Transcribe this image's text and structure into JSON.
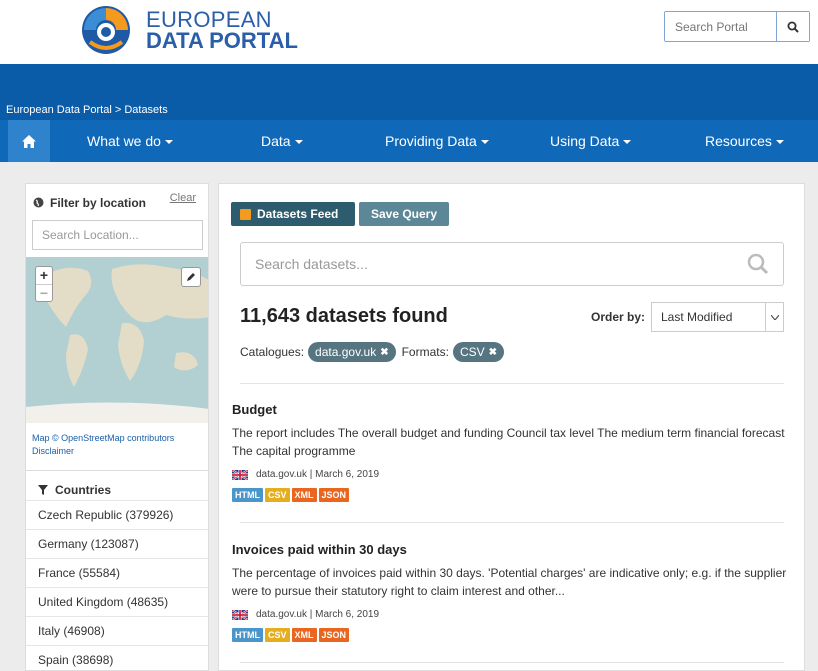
{
  "header": {
    "logo_line1": "EUROPEAN",
    "logo_line2": "DATA PORTAL",
    "search_placeholder": "Search Portal",
    "search_icon": "search-icon"
  },
  "breadcrumb": "European Data Portal > Datasets",
  "nav": {
    "home_icon": "home-icon",
    "items": [
      {
        "label": "What we do"
      },
      {
        "label": "Data"
      },
      {
        "label": "Providing Data"
      },
      {
        "label": "Using Data"
      },
      {
        "label": "Resources"
      }
    ]
  },
  "sidebar": {
    "filter_title": "Filter by location",
    "clear_label": "Clear",
    "location_placeholder": "Search Location...",
    "map_attribution": "Map © OpenStreetMap contributors",
    "map_disclaimer": "Disclaimer",
    "countries_title": "Countries",
    "countries": [
      "Czech Republic (379926)",
      "Germany (123087)",
      "France (55584)",
      "United Kingdom (48635)",
      "Italy (46908)",
      "Spain (38698)"
    ]
  },
  "main": {
    "feed_button": "Datasets Feed",
    "save_button": "Save Query",
    "search_placeholder": "Search datasets...",
    "results_count": "11,643 datasets found",
    "order_label": "Order by:",
    "order_value": "Last Modified",
    "catalogues_label": "Catalogues:",
    "catalogue_pill": "data.gov.uk",
    "formats_label": "Formats:",
    "format_pill": "CSV",
    "datasets": [
      {
        "title": "Budget",
        "description": "The report includes The overall budget and funding Council tax level The medium term financial forecast The capital programme",
        "meta": "data.gov.uk | March 6, 2019",
        "formats": [
          "HTML",
          "CSV",
          "XML",
          "JSON"
        ]
      },
      {
        "title": "Invoices paid within 30 days",
        "description": "The percentage of invoices paid within 30 days. 'Potential charges' are indicative only; e.g. if the supplier were to pursue their statutory right to claim interest and other...",
        "meta": "data.gov.uk | March 6, 2019",
        "formats": [
          "HTML",
          "CSV",
          "XML",
          "JSON"
        ]
      }
    ]
  },
  "colors": {
    "html_tag": "#4a95c9",
    "csv_tag": "#e6ad1e",
    "xml_tag": "#e8661f",
    "json_tag": "#e8661f",
    "nav_blue": "#1069b8",
    "band_blue": "#0b5ca8"
  }
}
